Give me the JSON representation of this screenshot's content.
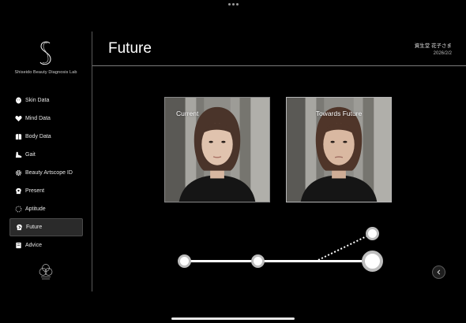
{
  "brand": {
    "name": "Shiseido Beauty Diagnosis Lab"
  },
  "nav": {
    "items": [
      {
        "label": "Skin Data",
        "icon": "face-icon"
      },
      {
        "label": "Mind Data",
        "icon": "heart-icon"
      },
      {
        "label": "Body Data",
        "icon": "body-icon"
      },
      {
        "label": "Gait",
        "icon": "shoe-icon"
      },
      {
        "label": "Beauty Artscope ID",
        "icon": "gear-icon"
      },
      {
        "label": "Present",
        "icon": "head-icon"
      },
      {
        "label": "Aptitude",
        "icon": "dotted-circle-icon"
      },
      {
        "label": "Future",
        "icon": "future-icon",
        "active": true
      },
      {
        "label": "Advice",
        "icon": "book-icon"
      }
    ]
  },
  "header": {
    "title": "Future",
    "user_name": "資生堂 花子さま",
    "date": "2026/2/2"
  },
  "photos": {
    "current_label": "Current",
    "future_label": "Towards Future"
  },
  "timeline": {
    "steps": 4,
    "selected_index": 3
  },
  "colors": {
    "background": "#000000",
    "active_nav": "#2a2a2a",
    "divider": "#7a7a7a"
  }
}
